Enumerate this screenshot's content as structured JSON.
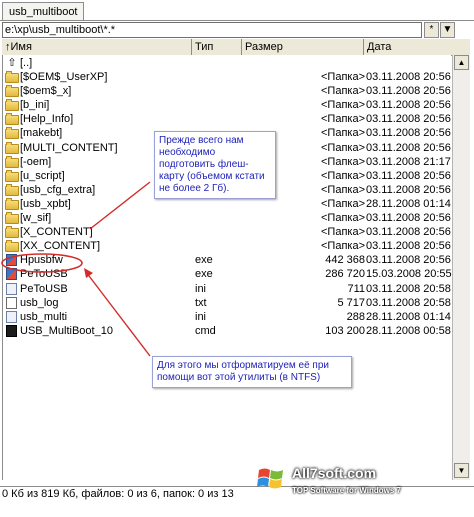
{
  "tab": {
    "label": "usb_multiboot"
  },
  "path": {
    "value": "e:\\xp\\usb_multiboot\\*.*"
  },
  "path_buttons": {
    "star": "*",
    "arrow": "▼"
  },
  "columns": {
    "name": "↑Имя",
    "type": "Тип",
    "size": "Размер",
    "date": "Дата"
  },
  "up_row": {
    "name": "[..]"
  },
  "rows": [
    {
      "icon": "folder-icon",
      "name": "[$OEM$_UserXP]",
      "type": "",
      "size": "<Папка>",
      "date": "03.11.2008 20:56"
    },
    {
      "icon": "folder-icon",
      "name": "[$oem$_x]",
      "type": "",
      "size": "<Папка>",
      "date": "03.11.2008 20:56"
    },
    {
      "icon": "folder-icon",
      "name": "[b_ini]",
      "type": "",
      "size": "<Папка>",
      "date": "03.11.2008 20:56"
    },
    {
      "icon": "folder-icon",
      "name": "[Help_Info]",
      "type": "",
      "size": "<Папка>",
      "date": "03.11.2008 20:56"
    },
    {
      "icon": "folder-icon",
      "name": "[makebt]",
      "type": "",
      "size": "<Папка>",
      "date": "03.11.2008 20:56"
    },
    {
      "icon": "folder-icon",
      "name": "[MULTI_CONTENT]",
      "type": "",
      "size": "<Папка>",
      "date": "03.11.2008 20:56"
    },
    {
      "icon": "folder-icon",
      "name": "[-oem]",
      "type": "",
      "size": "<Папка>",
      "date": "03.11.2008 21:17"
    },
    {
      "icon": "folder-icon",
      "name": "[u_script]",
      "type": "",
      "size": "<Папка>",
      "date": "03.11.2008 20:56"
    },
    {
      "icon": "folder-icon",
      "name": "[usb_cfg_extra]",
      "type": "",
      "size": "<Папка>",
      "date": "03.11.2008 20:56"
    },
    {
      "icon": "folder-icon",
      "name": "[usb_xpbt]",
      "type": "",
      "size": "<Папка>",
      "date": "28.11.2008 01:14"
    },
    {
      "icon": "folder-icon",
      "name": "[w_sif]",
      "type": "",
      "size": "<Папка>",
      "date": "03.11.2008 20:56"
    },
    {
      "icon": "folder-icon",
      "name": "[X_CONTENT]",
      "type": "",
      "size": "<Папка>",
      "date": "03.11.2008 20:56"
    },
    {
      "icon": "folder-icon",
      "name": "[XX_CONTENT]",
      "type": "",
      "size": "<Папка>",
      "date": "03.11.2008 20:56"
    },
    {
      "icon": "exe-icon",
      "name": "Hpusbfw",
      "type": "exe",
      "size": "442 368",
      "date": "03.11.2008 20:56"
    },
    {
      "icon": "exe-icon",
      "name": "PeToUSB",
      "type": "exe",
      "size": "286 720",
      "date": "15.03.2008 20:55"
    },
    {
      "icon": "ini-icon",
      "name": "PeToUSB",
      "type": "ini",
      "size": "711",
      "date": "03.11.2008 20:58"
    },
    {
      "icon": "txt-icon",
      "name": "usb_log",
      "type": "txt",
      "size": "5 717",
      "date": "03.11.2008 20:58"
    },
    {
      "icon": "ini-icon",
      "name": "usb_multi",
      "type": "ini",
      "size": "288",
      "date": "28.11.2008 01:14"
    },
    {
      "icon": "cmd-icon",
      "name": "USB_MultiBoot_10",
      "type": "cmd",
      "size": "103 200",
      "date": "28.11.2008 00:58"
    }
  ],
  "annotations": {
    "note1": "Прежде всего нам необходимо подготовить флеш-карту (объемом кстати не более 2 Гб).",
    "note2": "Для этого мы отформатируем её при помощи вот этой утилиты (в NTFS)"
  },
  "status": {
    "text": "0 Кб из 819 Кб, файлов: 0 из 6, папок: 0 из 13"
  },
  "watermark": {
    "site": "All7soft.com",
    "tagline": "TOP Software for Windows 7"
  },
  "colors": {
    "annotation_text": "#1b1fb8",
    "highlight": "#d42a2a",
    "folder": "#e8c34c"
  }
}
